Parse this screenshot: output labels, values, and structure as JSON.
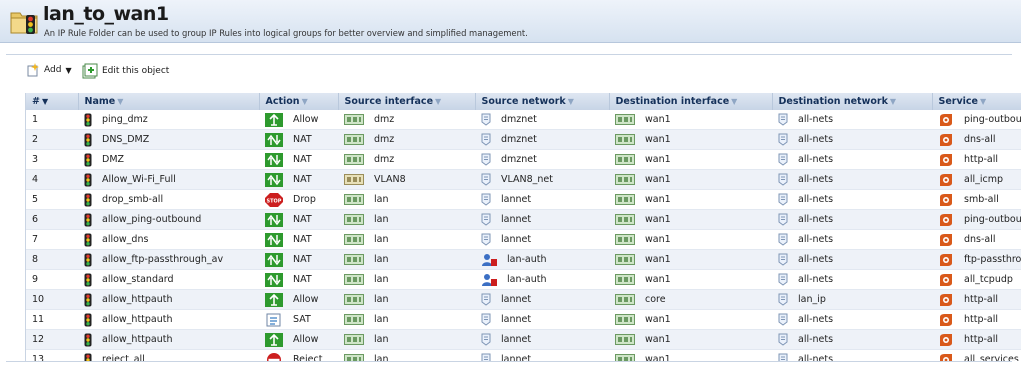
{
  "header": {
    "title": "lan_to_wan1",
    "subtitle": "An IP Rule Folder can be used to group IP Rules into logical groups for better overview and simplified management."
  },
  "toolbar": {
    "add_label": "Add",
    "edit_label": "Edit this object"
  },
  "columns": [
    "#",
    "Name",
    "Action",
    "Source interface",
    "Source network",
    "Destination interface",
    "Destination network",
    "Service"
  ],
  "rows": [
    {
      "num": "1",
      "name": "ping_dmz",
      "action": "Allow",
      "action_icon": "allow-icon",
      "src_if": "dmz",
      "src_if_icon": "interface-icon",
      "src_net": "dmznet",
      "src_net_icon": "network-icon",
      "dst_if": "wan1",
      "dst_net": "all-nets",
      "dst_net_icon": "network-icon",
      "service": "ping-outbound"
    },
    {
      "num": "2",
      "name": "DNS_DMZ",
      "action": "NAT",
      "action_icon": "nat-icon",
      "src_if": "dmz",
      "src_if_icon": "interface-icon",
      "src_net": "dmznet",
      "src_net_icon": "network-icon",
      "dst_if": "wan1",
      "dst_net": "all-nets",
      "dst_net_icon": "network-icon",
      "service": "dns-all"
    },
    {
      "num": "3",
      "name": "DMZ",
      "action": "NAT",
      "action_icon": "nat-icon",
      "src_if": "dmz",
      "src_if_icon": "interface-icon",
      "src_net": "dmznet",
      "src_net_icon": "network-icon",
      "dst_if": "wan1",
      "dst_net": "all-nets",
      "dst_net_icon": "network-icon",
      "service": "http-all"
    },
    {
      "num": "4",
      "name": "Allow_Wi-Fi_Full",
      "action": "NAT",
      "action_icon": "nat-icon",
      "src_if": "VLAN8",
      "src_if_icon": "vlan-icon",
      "src_net": "VLAN8_net",
      "src_net_icon": "network-icon",
      "dst_if": "wan1",
      "dst_net": "all-nets",
      "dst_net_icon": "network-icon",
      "service": "all_icmp"
    },
    {
      "num": "5",
      "name": "drop_smb-all",
      "action": "Drop",
      "action_icon": "drop-icon",
      "src_if": "lan",
      "src_if_icon": "interface-icon",
      "src_net": "lannet",
      "src_net_icon": "network-icon",
      "dst_if": "wan1",
      "dst_net": "all-nets",
      "dst_net_icon": "network-icon",
      "service": "smb-all"
    },
    {
      "num": "6",
      "name": "allow_ping-outbound",
      "action": "NAT",
      "action_icon": "nat-icon",
      "src_if": "lan",
      "src_if_icon": "interface-icon",
      "src_net": "lannet",
      "src_net_icon": "network-icon",
      "dst_if": "wan1",
      "dst_net": "all-nets",
      "dst_net_icon": "network-icon",
      "service": "ping-outbound"
    },
    {
      "num": "7",
      "name": "allow_dns",
      "action": "NAT",
      "action_icon": "nat-icon",
      "src_if": "lan",
      "src_if_icon": "interface-icon",
      "src_net": "lannet",
      "src_net_icon": "network-icon",
      "dst_if": "wan1",
      "dst_net": "all-nets",
      "dst_net_icon": "network-icon",
      "service": "dns-all"
    },
    {
      "num": "8",
      "name": "allow_ftp-passthrough_av",
      "action": "NAT",
      "action_icon": "nat-icon",
      "src_if": "lan",
      "src_if_icon": "interface-icon",
      "src_net": "lan-auth",
      "src_net_icon": "user-auth-icon",
      "dst_if": "wan1",
      "dst_net": "all-nets",
      "dst_net_icon": "network-icon",
      "service": "ftp-passthrough"
    },
    {
      "num": "9",
      "name": "allow_standard",
      "action": "NAT",
      "action_icon": "nat-icon",
      "src_if": "lan",
      "src_if_icon": "interface-icon",
      "src_net": "lan-auth",
      "src_net_icon": "user-auth-icon",
      "dst_if": "wan1",
      "dst_net": "all-nets",
      "dst_net_icon": "network-icon",
      "service": "all_tcpudp"
    },
    {
      "num": "10",
      "name": "allow_httpauth",
      "action": "Allow",
      "action_icon": "allow-icon",
      "src_if": "lan",
      "src_if_icon": "interface-icon",
      "src_net": "lannet",
      "src_net_icon": "network-icon",
      "dst_if": "core",
      "dst_net": "lan_ip",
      "dst_net_icon": "network-icon",
      "service": "http-all"
    },
    {
      "num": "11",
      "name": "allow_httpauth",
      "action": "SAT",
      "action_icon": "sat-icon",
      "src_if": "lan",
      "src_if_icon": "interface-icon",
      "src_net": "lannet",
      "src_net_icon": "network-icon",
      "dst_if": "wan1",
      "dst_net": "all-nets",
      "dst_net_icon": "network-icon",
      "service": "http-all"
    },
    {
      "num": "12",
      "name": "allow_httpauth",
      "action": "Allow",
      "action_icon": "allow-icon",
      "src_if": "lan",
      "src_if_icon": "interface-icon",
      "src_net": "lannet",
      "src_net_icon": "network-icon",
      "dst_if": "wan1",
      "dst_net": "all-nets",
      "dst_net_icon": "network-icon",
      "service": "http-all"
    },
    {
      "num": "13",
      "name": "reject_all",
      "action": "Reject",
      "action_icon": "reject-icon",
      "src_if": "lan",
      "src_if_icon": "interface-icon",
      "src_net": "lannet",
      "src_net_icon": "network-icon",
      "dst_if": "wan1",
      "dst_net": "all-nets",
      "dst_net_icon": "network-icon",
      "service": "all_services"
    }
  ],
  "colors": {
    "header_bg": "#d6e2f0",
    "column_header_text": "#15315a",
    "allow_green": "#2e9a2e",
    "drop_red": "#cc1f1f",
    "service_orange": "#d9591a"
  }
}
